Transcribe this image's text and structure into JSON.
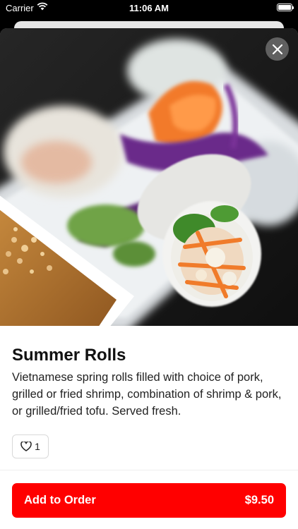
{
  "status_bar": {
    "carrier": "Carrier",
    "time": "11:06 AM"
  },
  "item": {
    "name": "Summer Rolls",
    "description": "Vietnamese spring rolls filled with choice of pork, grilled or fried shrimp, combination of shrimp & pork, or grilled/fried tofu. Served fresh.",
    "likes": "1",
    "photo_icon": "food-photo"
  },
  "order": {
    "label": "Add to Order",
    "price": "$9.50"
  },
  "icons": {
    "close": "close-icon",
    "like": "heart-icon"
  },
  "colors": {
    "primary": "#ff0000",
    "text": "#222222",
    "status_text": "#ffffff"
  }
}
